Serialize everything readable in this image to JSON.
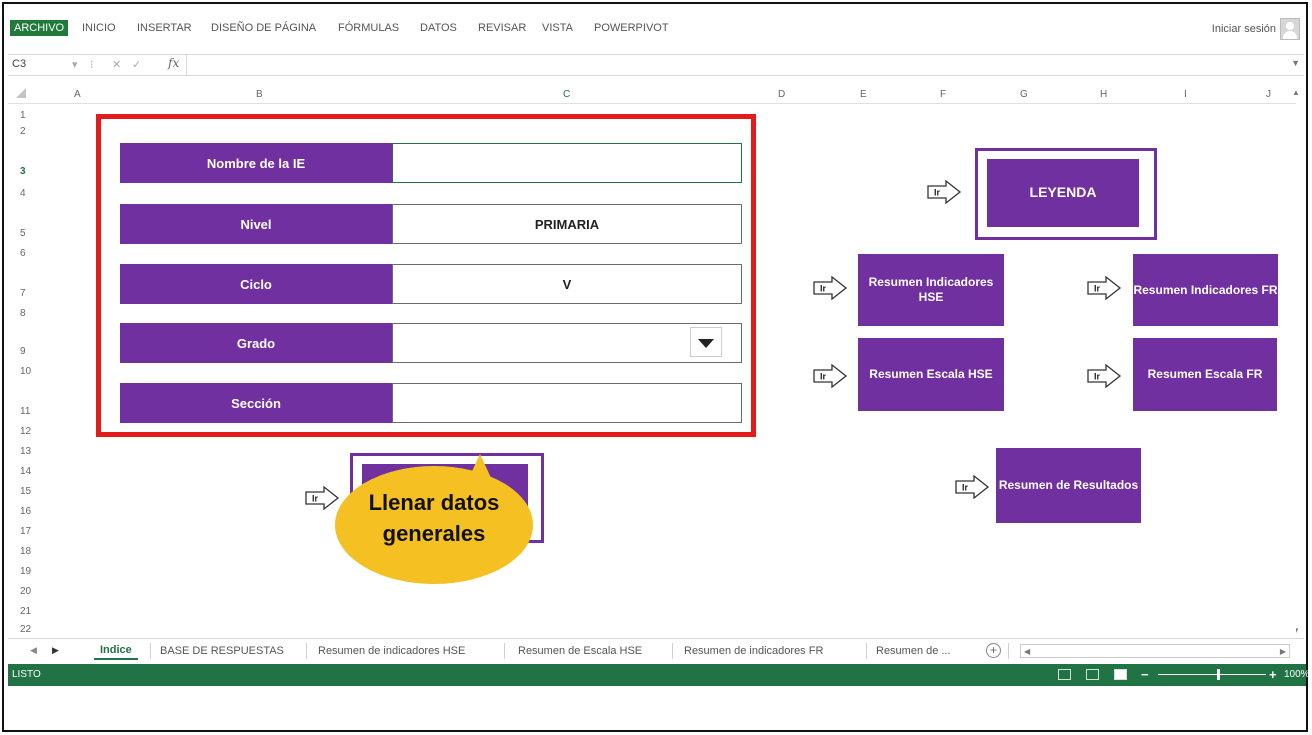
{
  "ribbon": {
    "tabs": [
      "ARCHIVO",
      "INICIO",
      "INSERTAR",
      "DISEÑO DE PÁGINA",
      "FÓRMULAS",
      "DATOS",
      "REVISAR",
      "VISTA",
      "POWERPIVOT"
    ],
    "signin": "Iniciar sesión"
  },
  "formula_bar": {
    "name_box": "C3",
    "fx": "fx"
  },
  "columns": [
    "A",
    "B",
    "C",
    "D",
    "E",
    "F",
    "G",
    "H",
    "I",
    "J"
  ],
  "rows": [
    "1",
    "2",
    "3",
    "4",
    "5",
    "6",
    "7",
    "8",
    "9",
    "10",
    "11",
    "12",
    "13",
    "14",
    "15",
    "16",
    "17",
    "18",
    "19",
    "20",
    "21",
    "22"
  ],
  "form": {
    "fields": [
      {
        "label": "Nombre de la IE",
        "value": ""
      },
      {
        "label": "Nivel",
        "value": "PRIMARIA"
      },
      {
        "label": "Ciclo",
        "value": "V"
      },
      {
        "label": "Grado",
        "value": ""
      },
      {
        "label": "Sección",
        "value": ""
      }
    ]
  },
  "buttons": {
    "leyenda": "LEYENDA",
    "resumen_ind_hse": "Resumen Indicadores HSE",
    "resumen_ind_fr": "Resumen Indicadores FR",
    "resumen_esc_hse": "Resumen Escala HSE",
    "resumen_esc_fr": "Resumen Escala FR",
    "resumen_resultados": "Resumen de Resultados",
    "ir": "Ir"
  },
  "callout": {
    "line1": "Llenar datos",
    "line2": "generales"
  },
  "sheet_tabs": [
    "Indice",
    "BASE DE RESPUESTAS",
    "Resumen de indicadores HSE",
    "Resumen de Escala HSE",
    "Resumen de indicadores FR",
    "Resumen de ..."
  ],
  "status": {
    "text": "LISTO",
    "zoom": "100%"
  },
  "colors": {
    "purple": "#7030a0",
    "red": "#e31b1b",
    "excel_green": "#217346",
    "callout": "#f5c022"
  }
}
